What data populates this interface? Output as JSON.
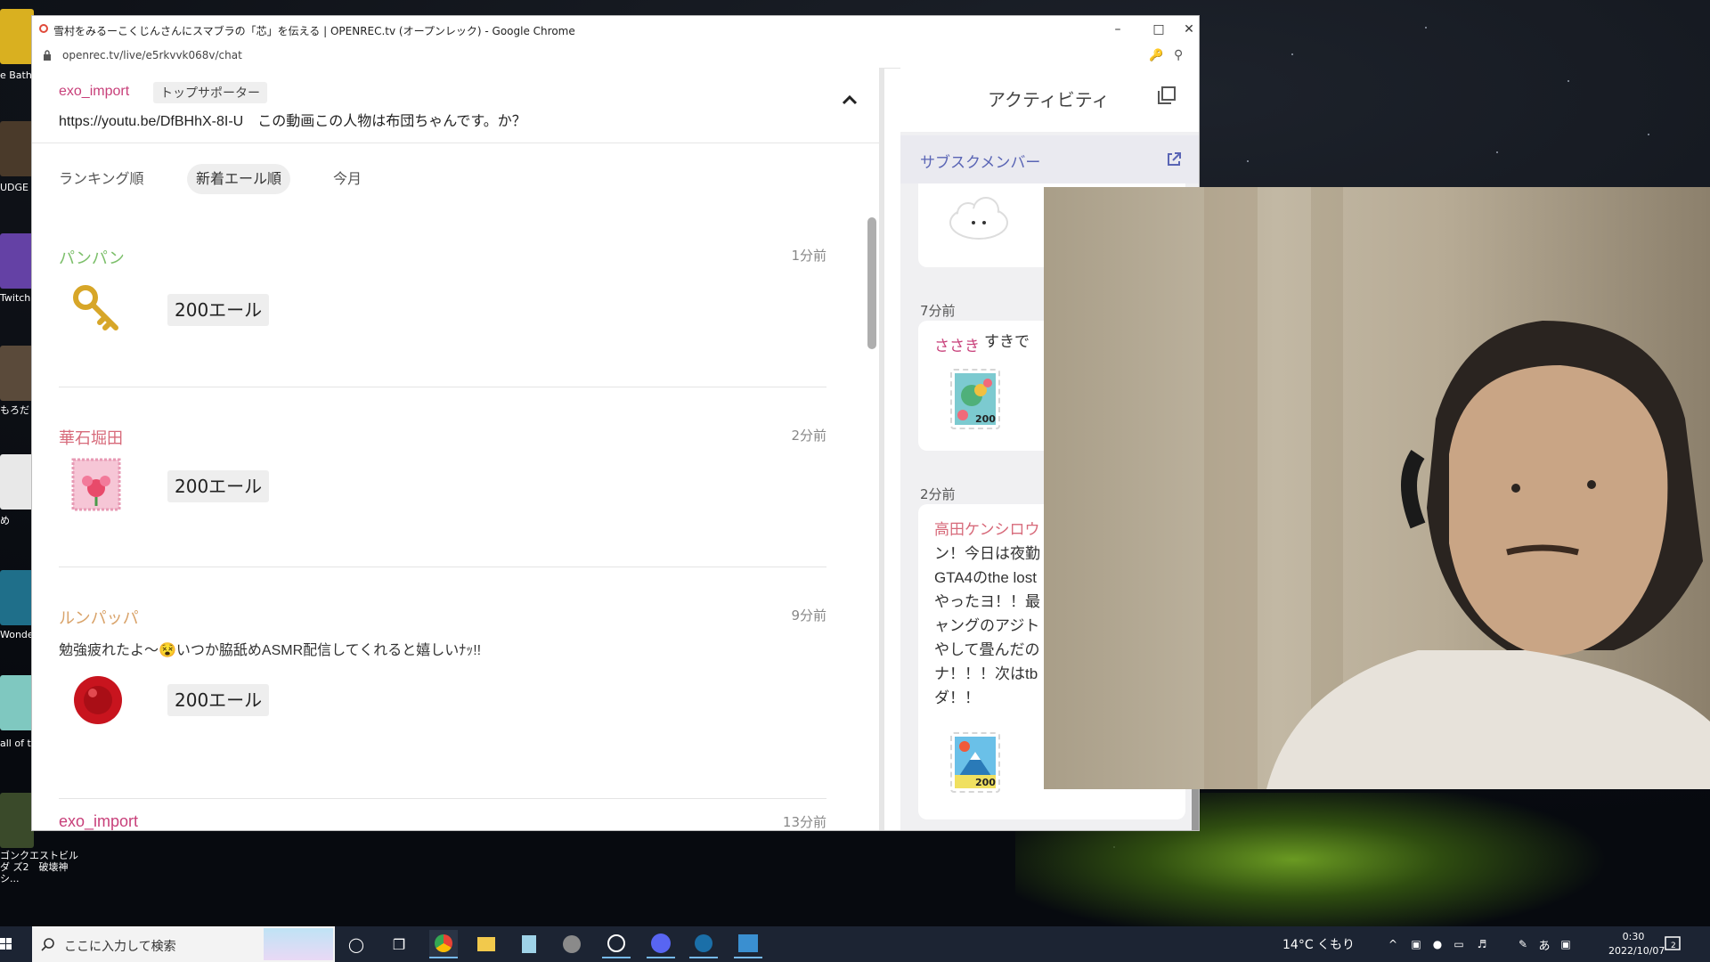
{
  "browser": {
    "title": "雪村をみるーこくじんさんにスマブラの「芯」を伝える | OPENREC.tv (オープンレック) - Google Chrome",
    "url": "openrec.tv/live/e5rkvvk068v/chat"
  },
  "pinned": {
    "user": "exo_import",
    "badge": "トップサポーター",
    "message": "https://youtu.be/DfBHhX-8I-U　この動画この人物は布団ちゃんです。か？"
  },
  "sort_tabs": [
    "ランキング順",
    "新着エール順",
    "今月"
  ],
  "sort_active": 1,
  "feed": [
    {
      "name": "パンパン",
      "time": "1分前",
      "message": "",
      "amount": "200エール",
      "name_color": "#7cbf6a",
      "gift": "golden-key"
    },
    {
      "name": "華石堀田",
      "time": "2分前",
      "message": "",
      "amount": "200エール",
      "name_color": "#d76a7a",
      "gift": "flower-stamp"
    },
    {
      "name": "ルンパッパ",
      "time": "9分前",
      "message": "勉強疲れたよ〜😵いつか脇舐めASMR配信してくれると嬉しいﾅｯ!!",
      "amount": "200エール",
      "name_color": "#d9a36a",
      "gift": "red-seal"
    },
    {
      "name": "exo_import",
      "time": "13分前",
      "message": "",
      "amount": "",
      "name_color": "#c8407a",
      "gift": ""
    }
  ],
  "activity": {
    "title": "アクティビティ",
    "subscribe_label": "サブスクメンバー",
    "cards": [
      {
        "time": "",
        "name": "",
        "text": "",
        "stamp": "cloud"
      },
      {
        "time": "7分前",
        "name": "ささき",
        "text": "すきで",
        "stamp": "parrot-200"
      },
      {
        "time": "2分前",
        "name": "高田ケンシロウ",
        "text_lines": [
          "ン！今日は夜勤",
          "GTA4のthe lost",
          "やったヨ！！最",
          "ャングのアジト",
          "やして畳んだの",
          "ナ！！！次はtb",
          "ダ！！"
        ],
        "stamp": "fuji-200"
      }
    ]
  },
  "taskbar": {
    "search_placeholder": "ここに入力して検索",
    "weather": "14°C くもり",
    "time": "0:30",
    "date": "2022/10/07",
    "notifications": "2"
  },
  "desktop_icons": [
    {
      "label": "e Bath\n源泉"
    },
    {
      "label": "UDGE E\nの遺言"
    },
    {
      "label": "Twitch"
    },
    {
      "label": "もろだ"
    },
    {
      "label": "め"
    },
    {
      "label": "Wonde\nFilmo"
    },
    {
      "label": "all of t\nThe Ar"
    },
    {
      "label": "ゴンクエストビルダ\nズ2　破壊神シ..."
    }
  ],
  "colors": {
    "brand_pink": "#c8407a",
    "subscribe_blue": "#5a65b5",
    "taskbar": "#1c2433"
  }
}
